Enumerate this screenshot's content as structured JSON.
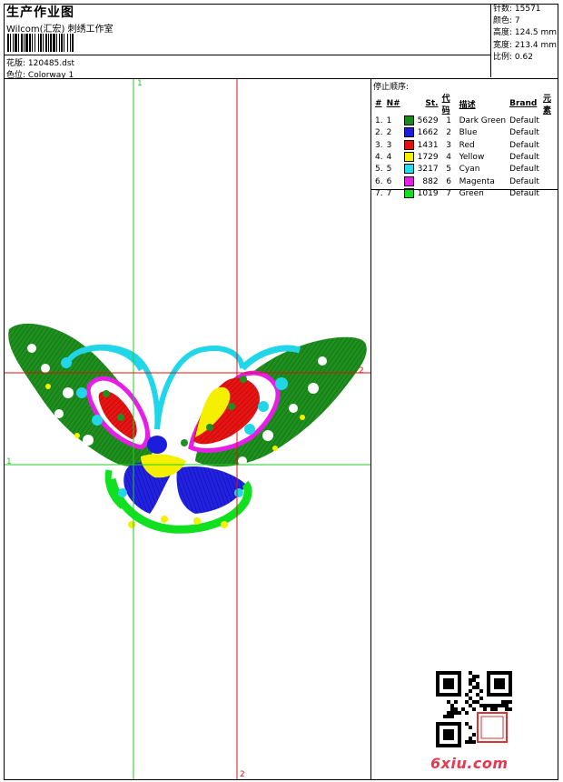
{
  "header": {
    "title": "生产作业图",
    "subtitle": "Wilcom(汇宏) 刺绣工作室",
    "design_label": "花版:",
    "design_file": "120485.dst",
    "colorway_label": "色位:",
    "colorway": "Colorway 1"
  },
  "stats": {
    "stitches": "针数: 15571",
    "colors": "颜色: 7",
    "height": "高度: 124.5 mm",
    "width": "宽度: 213.4 mm",
    "scale": "比例: 0.62"
  },
  "sequence": {
    "title": "停止顺序:",
    "columns": [
      "#",
      "N#",
      "St.",
      "代码",
      "描述",
      "Brand",
      "元素"
    ],
    "rows": [
      {
        "idx": "1. 1",
        "color": "#1a8a1a",
        "stitches": "5629",
        "code": "1",
        "desc": "Dark Green",
        "brand": "Default"
      },
      {
        "idx": "2. 2",
        "color": "#1c1cdc",
        "stitches": "1662",
        "code": "2",
        "desc": "Blue",
        "brand": "Default"
      },
      {
        "idx": "3. 3",
        "color": "#e01010",
        "stitches": "1431",
        "code": "3",
        "desc": "Red",
        "brand": "Default"
      },
      {
        "idx": "4. 4",
        "color": "#f5f000",
        "stitches": "1729",
        "code": "4",
        "desc": "Yellow",
        "brand": "Default"
      },
      {
        "idx": "5. 5",
        "color": "#20dcee",
        "stitches": "3217",
        "code": "5",
        "desc": "Cyan",
        "brand": "Default"
      },
      {
        "idx": "6. 6",
        "color": "#e61ee6",
        "stitches": "882",
        "code": "6",
        "desc": "Magenta",
        "brand": "Default"
      },
      {
        "idx": "7. 7",
        "color": "#10e020",
        "stitches": "1019",
        "code": "7",
        "desc": "Green",
        "brand": "Default"
      }
    ]
  },
  "axes": {
    "v1": "1",
    "h1": "1",
    "v2": "2",
    "h2": "2"
  },
  "watermark": "6xiu.com",
  "colors": {
    "green_axis": "#22cc22",
    "red_axis": "#e01010"
  }
}
